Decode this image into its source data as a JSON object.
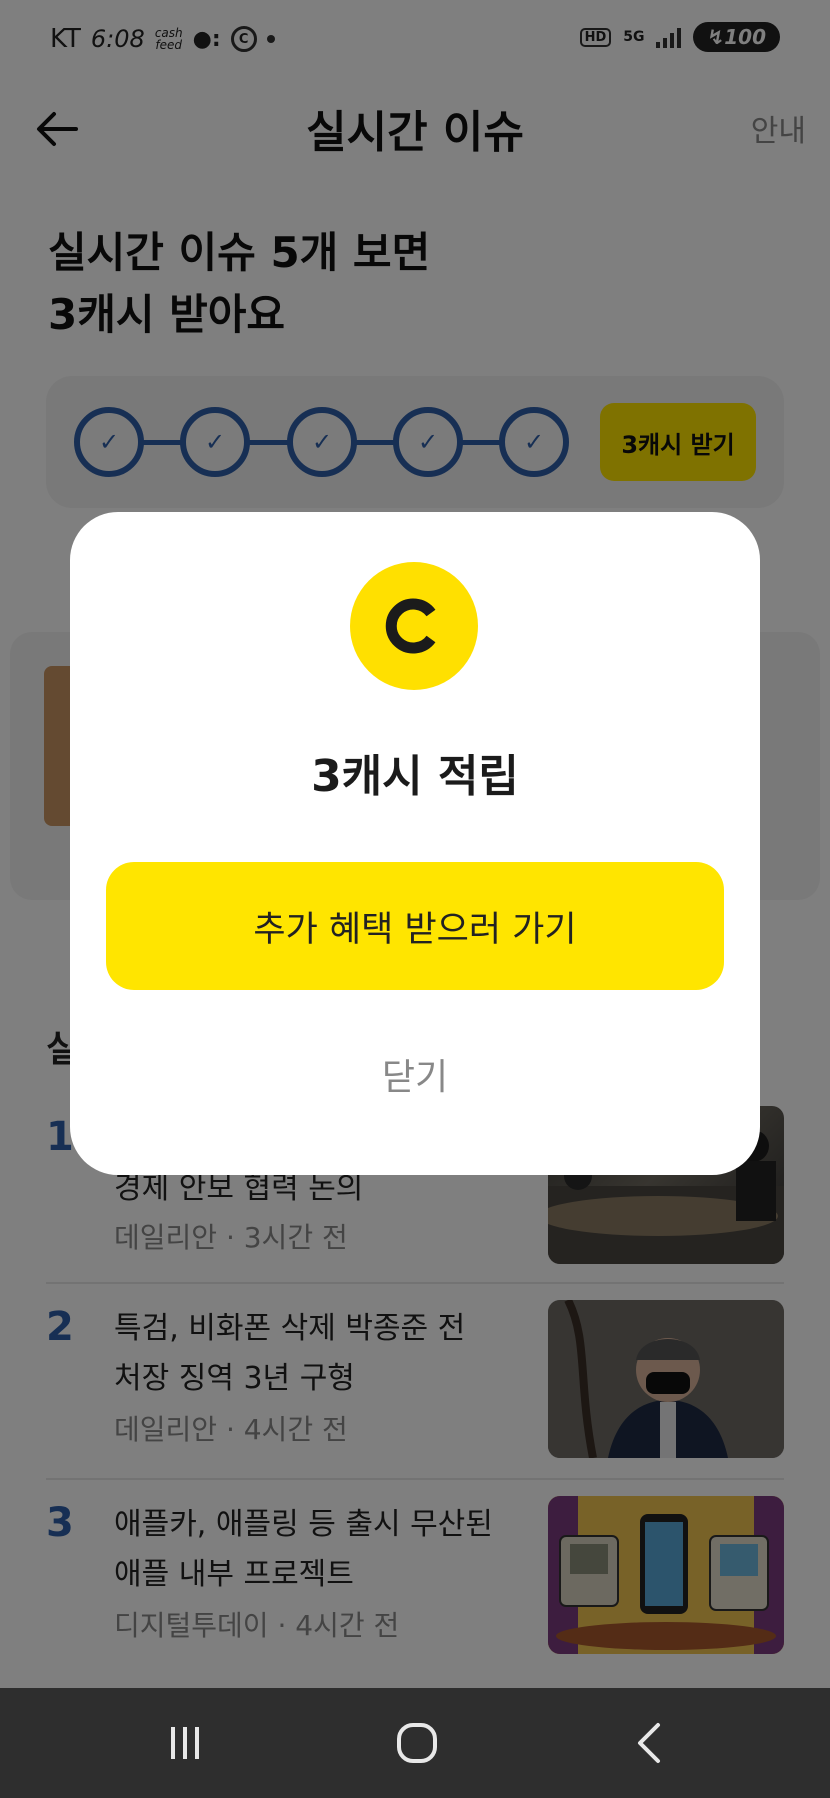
{
  "status_bar": {
    "carrier": "KT",
    "time": "6:08",
    "app_badge_top": "cash",
    "app_badge_bottom": "feed",
    "hd": "HD",
    "network": "5G",
    "battery": "100"
  },
  "header": {
    "title": "실시간 이슈",
    "guide_label": "안내"
  },
  "headline": {
    "line1": "실시간 이슈 5개 보면",
    "line2": "3캐시 받아요"
  },
  "progress": {
    "completed_steps": 5,
    "total_steps": 5,
    "claim_label": "3캐시 받기"
  },
  "section": {
    "title": "실"
  },
  "news": [
    {
      "rank": "1",
      "title_line2": "경제 안보 협력 논의",
      "source": "데일리안 · 3시간 전"
    },
    {
      "rank": "2",
      "title_line1": "특검, 비화폰 삭제 박종준 전",
      "title_line2": "처장 징역 3년 구형",
      "source": "데일리안 · 4시간 전"
    },
    {
      "rank": "3",
      "title_line1": "애플카, 애플링 등 출시 무산된",
      "title_line2": "애플 내부 프로젝트",
      "source": "디지털투데이 · 4시간 전"
    }
  ],
  "modal": {
    "coin_letter": "C",
    "title": "3캐시 적립",
    "primary_label": "추가 혜택 받으러 가기",
    "close_label": "닫기"
  },
  "colors": {
    "accent_yellow": "#ffe500",
    "progress_blue": "#2f5fa8",
    "overlay": "rgba(0,0,0,0.5)"
  }
}
